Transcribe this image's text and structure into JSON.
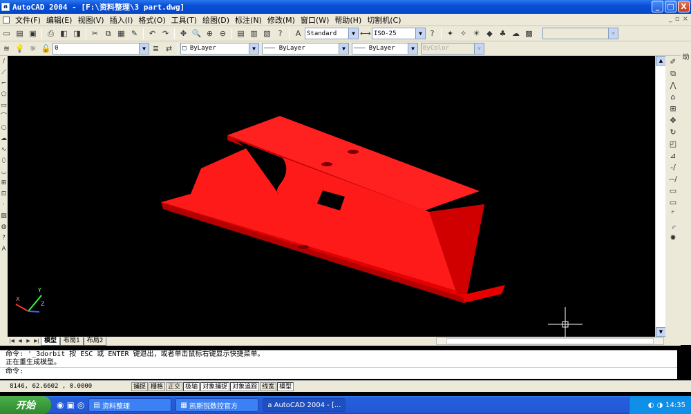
{
  "window": {
    "title": "AutoCAD 2004 - [F:\\资料整理\\3 part.dwg]",
    "buttons": [
      "_",
      "□",
      "X"
    ]
  },
  "menu": {
    "items": [
      "文件(F)",
      "编辑(E)",
      "视图(V)",
      "插入(I)",
      "格式(O)",
      "工具(T)",
      "绘图(D)",
      "标注(N)",
      "修改(M)",
      "窗口(W)",
      "帮助(H)",
      "切割机(C)"
    ]
  },
  "toolbar": {
    "text_style": "Standard",
    "dim_style": "ISO-25",
    "layer": "0",
    "color": "ByLayer",
    "linetype": "ByLayer",
    "lineweight": "ByLayer",
    "plotstyle": "ByColor"
  },
  "layout_tabs": [
    "模型",
    "布局1",
    "布局2"
  ],
  "command": {
    "line1": "命令: '_3dorbit 按 ESC 或 ENTER 键退出，或者单击鼠标右键显示快捷菜单。",
    "line2": "正在重生成模型。",
    "prompt": "命令:"
  },
  "status": {
    "coords": "8146, 62.6602 , 0.0000",
    "toggles": [
      "捕捉",
      "栅格",
      "正交",
      "极轴",
      "对象捕捉",
      "对象追踪",
      "线宽",
      "模型"
    ]
  },
  "taskbar": {
    "start": "开始",
    "tasks": [
      "资料整理",
      "凯斯锐数控官方",
      "AutoCAD 2004 - [..."
    ],
    "clock": "14:35"
  },
  "colors": {
    "part_red": "#ff1a1a",
    "titlebar_blue": "#0a4fd6",
    "canvas": "#000000"
  }
}
